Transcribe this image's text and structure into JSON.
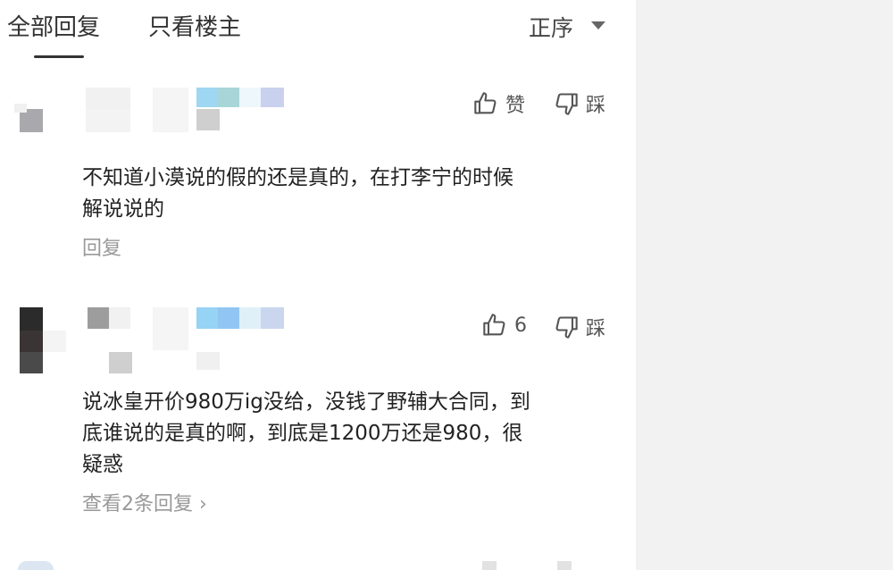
{
  "tabs": {
    "all_label": "全部回复",
    "owner_only_label": "只看楼主"
  },
  "sort": {
    "label": "正序"
  },
  "comments": [
    {
      "like_label": "赞",
      "dislike_label": "踩",
      "text_line1": "不知道小漠说的假的还是真的，在打李宁的时候",
      "text_line2": "解说说的",
      "reply_label": "回复"
    },
    {
      "like_label": "6",
      "dislike_label": "踩",
      "text_line1": "说冰皇开价980万ig没给，没钱了野辅大合同，到",
      "text_line2": "底谁说的是真的啊，到底是1200万还是980，很",
      "text_line3": "疑惑",
      "reply_label": "查看2条回复 ›"
    }
  ],
  "icons": {
    "like": "thumbs-up-icon",
    "dislike": "thumbs-down-icon",
    "sort": "caret-down-icon"
  }
}
